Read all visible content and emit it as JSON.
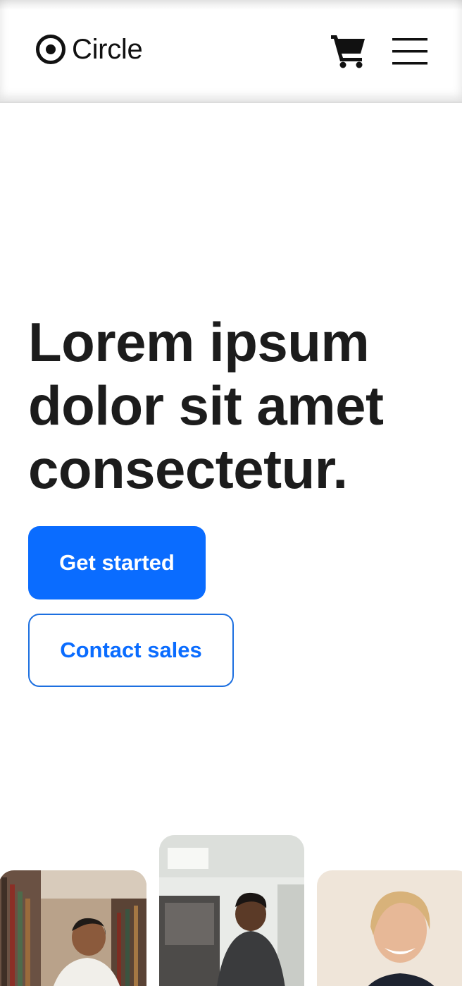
{
  "header": {
    "brand_name": "Circle",
    "logo_icon": "circle-dot-icon",
    "cart_icon": "shopping-cart-icon",
    "menu_icon": "hamburger-menu-icon"
  },
  "hero": {
    "headline": "Lorem ipsum dolor sit amet consectetur.",
    "primary_cta": "Get started",
    "secondary_cta": "Contact sales"
  },
  "gallery": {
    "images": [
      "man-reading-in-library",
      "man-at-office-desk",
      "smiling-woman-portrait"
    ]
  },
  "colors": {
    "accent": "#0a6cff",
    "text": "#1c1c1c",
    "divider": "#dcdcdc"
  }
}
